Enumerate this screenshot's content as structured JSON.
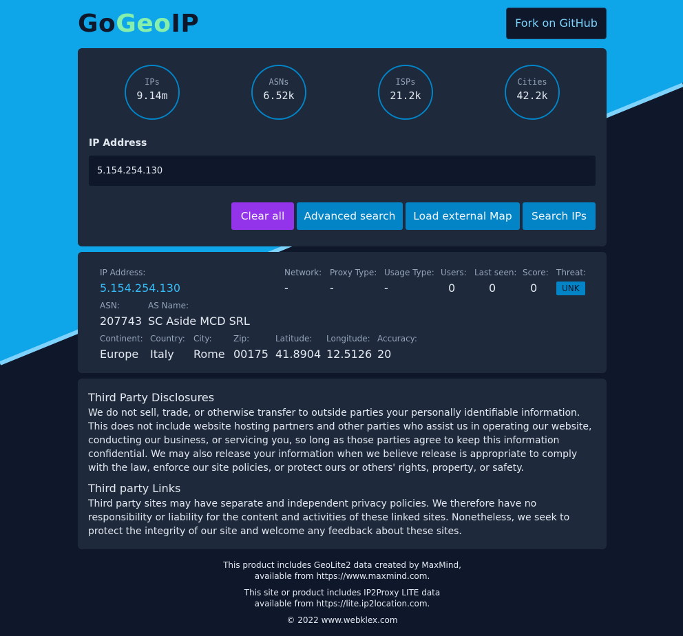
{
  "header": {
    "logo_go": "Go",
    "logo_geo": "Geo",
    "logo_ip": "IP",
    "github_button": "Fork on GitHub"
  },
  "stats": [
    {
      "label": "IPs",
      "value": "9.14m"
    },
    {
      "label": "ASNs",
      "value": "6.52k"
    },
    {
      "label": "ISPs",
      "value": "21.2k"
    },
    {
      "label": "Cities",
      "value": "42.2k"
    }
  ],
  "search": {
    "label": "IP Address",
    "value": "5.154.254.130",
    "buttons": {
      "clear": "Clear all",
      "advanced": "Advanced search",
      "map": "Load external Map",
      "search": "Search IPs"
    }
  },
  "result": {
    "ip_address_label": "IP Address:",
    "ip_address": "5.154.254.130",
    "network_label": "Network:",
    "network": "-",
    "proxy_type_label": "Proxy Type:",
    "proxy_type": "-",
    "usage_type_label": "Usage Type:",
    "usage_type": "-",
    "users_label": "Users:",
    "users": "0",
    "last_seen_label": "Last seen:",
    "last_seen": "0",
    "score_label": "Score:",
    "score": "0",
    "threat_label": "Threat:",
    "threat": "UNK",
    "asn_label": "ASN:",
    "asn": "207743",
    "as_name_label": "AS Name:",
    "as_name": "SC Aside MCD SRL",
    "continent_label": "Continent:",
    "continent": "Europe",
    "country_label": "Country:",
    "country": "Italy",
    "city_label": "City:",
    "city": "Rome",
    "zip_label": "Zip:",
    "zip": "00175",
    "latitude_label": "Latitude:",
    "latitude": "41.8904",
    "longitude_label": "Longitude:",
    "longitude": "12.5126",
    "accuracy_label": "Accuracy:",
    "accuracy": "20"
  },
  "disclosures": {
    "heading1": "Third Party Disclosures",
    "text1": "We do not sell, trade, or otherwise transfer to outside parties your personally identifiable information. This does not include website hosting partners and other parties who assist us in operating our website, conducting our business, or servicing you, so long as those parties agree to keep this information confidential. We may also release your information when we believe release is appropriate to comply with the law, enforce our site policies, or protect ours or others' rights, property, or safety.",
    "heading2": "Third party Links",
    "text2": "Third party sites may have separate and independent privacy policies. We therefore have no responsibility or liability for the content and activities of these linked sites. Nonetheless, we seek to protect the integrity of our site and welcome any feedback about these sites."
  },
  "footer": {
    "maxmind_line1": "This product includes GeoLite2 data created by MaxMind,",
    "maxmind_line2": "available from https://www.maxmind.com.",
    "ip2_line1": "This site or product includes IP2Proxy LITE data",
    "ip2_line2": "available from https://lite.ip2location.com.",
    "copyright": "© 2022 www.webklex.com"
  },
  "colors": {
    "background_top": "#0ea5e9",
    "background_bottom": "#0f172a",
    "card": "#1e293b",
    "accent_blue": "#0284c7",
    "accent_purple": "#9333ea",
    "logo_geo": "#86efac",
    "link": "#38bdf8"
  }
}
